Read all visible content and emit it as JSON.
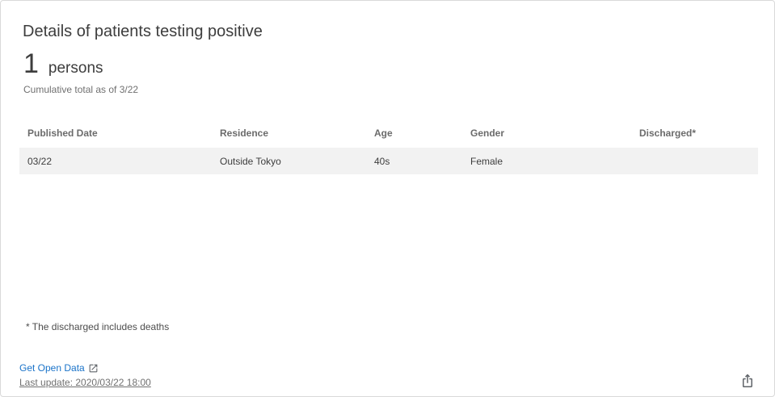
{
  "card": {
    "title": "Details of patients testing positive",
    "total_value": "1",
    "total_unit": "persons",
    "subtitle": "Cumulative total as of 3/22"
  },
  "table": {
    "headers": [
      "Published Date",
      "Residence",
      "Age",
      "Gender",
      "Discharged*"
    ],
    "rows": [
      [
        "03/22",
        "Outside Tokyo",
        "40s",
        "Female",
        ""
      ]
    ]
  },
  "footer": {
    "note": "* The discharged includes deaths",
    "open_data_label": "Get Open Data",
    "last_update": "Last update: 2020/03/22 18:00"
  },
  "icons": {
    "external_link": "external-link-icon",
    "share": "share-icon"
  },
  "colors": {
    "link": "#1a73c9",
    "row_bg": "#f2f2f2"
  }
}
